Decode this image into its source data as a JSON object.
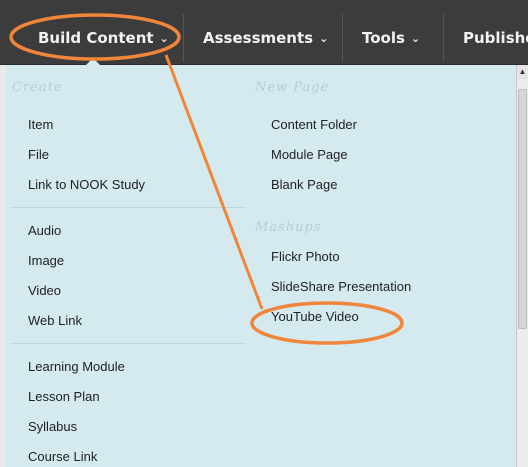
{
  "toolbar": {
    "tabs": [
      {
        "label": "Build Content",
        "chevron": "⌄"
      },
      {
        "label": "Assessments",
        "chevron": "⌄"
      },
      {
        "label": "Tools",
        "chevron": "⌄"
      },
      {
        "label": "Publisher"
      }
    ]
  },
  "menu": {
    "create_heading": "Create",
    "new_page_heading": "New Page",
    "mashups_heading": "Mashups",
    "create_items": [
      "Item",
      "File",
      "Link to NOOK Study"
    ],
    "media_items": [
      "Audio",
      "Image",
      "Video",
      "Web Link"
    ],
    "learning_items": [
      "Learning Module",
      "Lesson Plan",
      "Syllabus",
      "Course Link"
    ],
    "new_page_items": [
      "Content Folder",
      "Module Page",
      "Blank Page"
    ],
    "mashup_items": [
      "Flickr Photo",
      "SlideShare Presentation",
      "YouTube Video"
    ]
  },
  "annotation": {
    "color": "#f0863a"
  },
  "scrollbar": {
    "up_arrow": "▲"
  }
}
